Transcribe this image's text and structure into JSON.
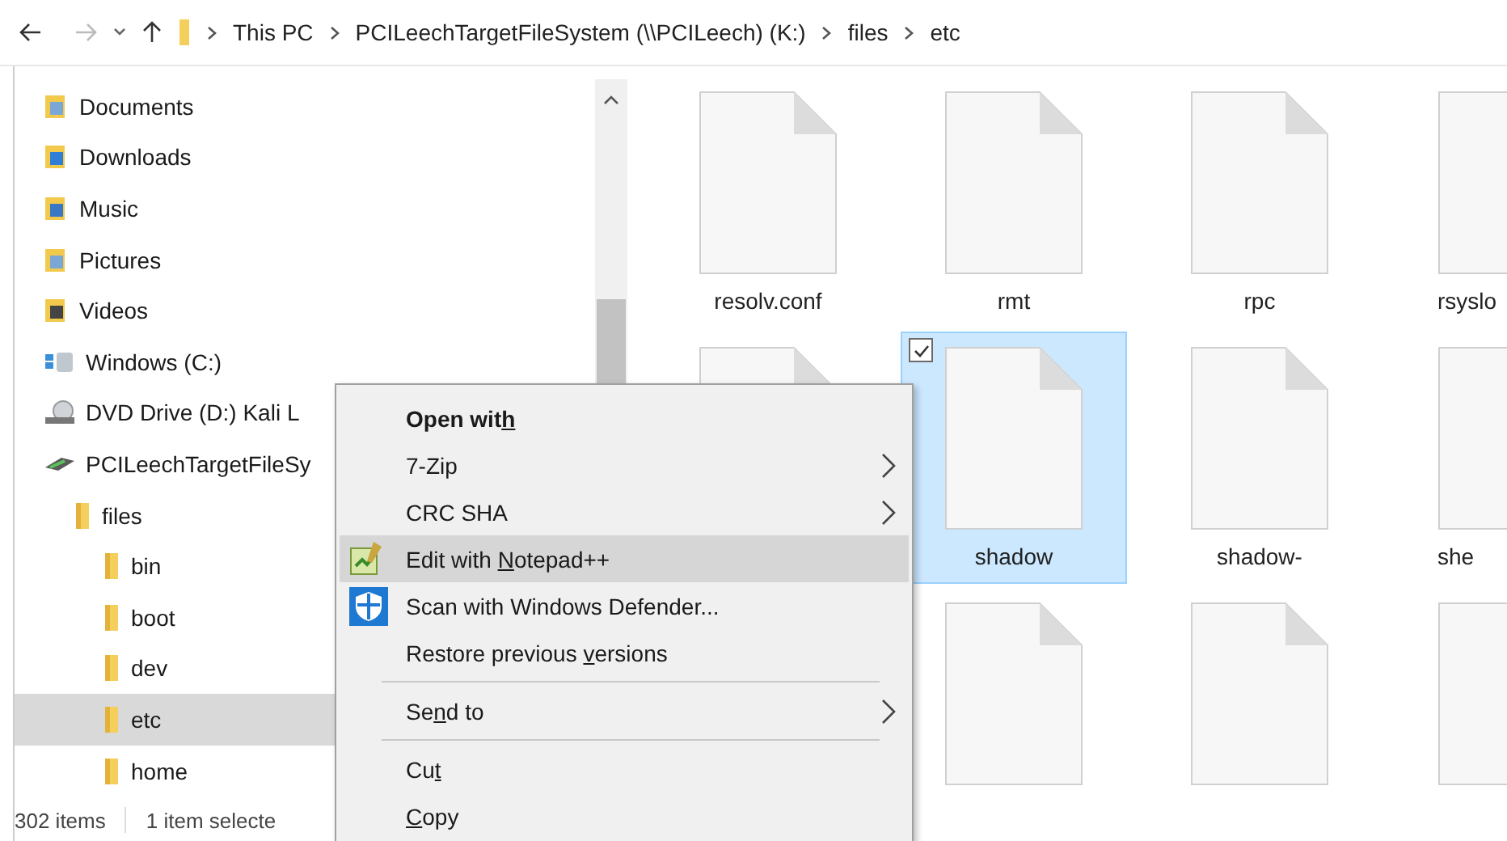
{
  "address_bar": {
    "breadcrumbs": [
      "This PC",
      "PCILeechTargetFileSystem (\\\\PCILeech) (K:)",
      "files",
      "etc"
    ]
  },
  "navigation": {
    "items": [
      {
        "label": "Documents",
        "kind": "documents",
        "selected": false
      },
      {
        "label": "Downloads",
        "kind": "downloads",
        "selected": false
      },
      {
        "label": "Music",
        "kind": "music",
        "selected": false
      },
      {
        "label": "Pictures",
        "kind": "pictures",
        "selected": false
      },
      {
        "label": "Videos",
        "kind": "videos",
        "selected": false
      },
      {
        "label": "Windows (C:)",
        "kind": "drive",
        "selected": false
      },
      {
        "label": "DVD Drive (D:) Kali L",
        "kind": "dvd",
        "selected": false
      },
      {
        "label": "PCILeechTargetFileSy",
        "kind": "network",
        "selected": false,
        "children": [
          {
            "label": "files",
            "kind": "folder",
            "selected": false,
            "children": [
              {
                "label": "bin",
                "kind": "folder",
                "selected": false
              },
              {
                "label": "boot",
                "kind": "folder",
                "selected": false
              },
              {
                "label": "dev",
                "kind": "folder",
                "selected": false
              },
              {
                "label": "etc",
                "kind": "folder",
                "selected": true
              },
              {
                "label": "home",
                "kind": "folder",
                "selected": false
              }
            ]
          }
        ]
      }
    ]
  },
  "file_rows": [
    {
      "items": [
        {
          "name": "resolv.conf",
          "selected": false
        },
        {
          "name": "rmt",
          "selected": false
        },
        {
          "name": "rpc",
          "selected": false
        },
        {
          "name": "rsyslo",
          "selected": false
        }
      ]
    },
    {
      "items": [
        {
          "selected": false
        },
        {
          "name": "shadow",
          "selected": true,
          "checked": true
        },
        {
          "name": "shadow-",
          "selected": false
        },
        {
          "name": "she",
          "selected": false
        }
      ]
    },
    {
      "items": [
        {
          "selected": false
        },
        {
          "selected": false
        },
        {
          "selected": false
        }
      ]
    }
  ],
  "status_bar": {
    "item_count": "302 items",
    "selection": "1 item selecte"
  },
  "context_menu": {
    "items": [
      {
        "kind": "plain",
        "before": "Open wit",
        "key": "h",
        "bold": true,
        "highlighted": false
      },
      {
        "kind": "plain",
        "before": "7-Zip",
        "submenu": true,
        "highlighted": false
      },
      {
        "kind": "plain",
        "before": "CRC SHA",
        "submenu": true,
        "highlighted": false
      },
      {
        "kind": "notepad",
        "before": "Edit with ",
        "key": "N",
        "after": "otepad++",
        "highlighted": true
      },
      {
        "kind": "defender",
        "before": "Scan with Windows Defender...",
        "highlighted": false
      },
      {
        "kind": "plain",
        "before": "Restore previous ",
        "key": "v",
        "after": "ersions",
        "highlighted": false
      },
      {
        "kind": "separator"
      },
      {
        "kind": "plain",
        "before": "Se",
        "key": "n",
        "after": "d to",
        "submenu": true,
        "highlighted": false
      },
      {
        "kind": "separator"
      },
      {
        "kind": "plain",
        "before": "Cu",
        "key": "t",
        "highlighted": false
      },
      {
        "kind": "plain",
        "key": "C",
        "after": "opy",
        "highlighted": false
      }
    ]
  }
}
